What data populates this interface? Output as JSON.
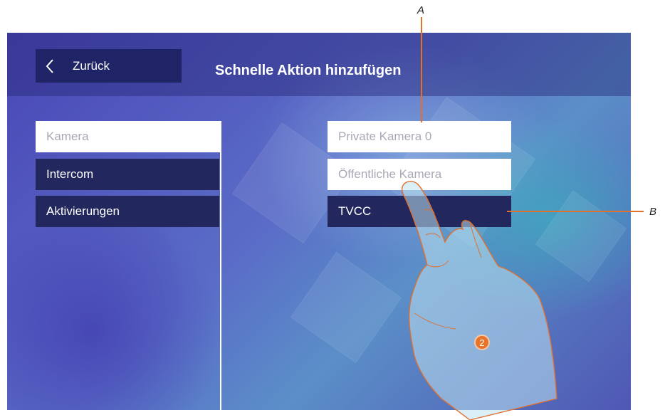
{
  "header": {
    "back_label": "Zurück",
    "title": "Schnelle Aktion hinzufügen"
  },
  "categories": [
    {
      "label": "Kamera",
      "selected": true
    },
    {
      "label": "Intercom",
      "selected": false
    },
    {
      "label": "Aktivierungen",
      "selected": false
    }
  ],
  "options": [
    {
      "label": "Private Kamera 0",
      "selected": true
    },
    {
      "label": "Öffentliche Kamera",
      "selected": true
    },
    {
      "label": "TVCC",
      "selected": false
    }
  ],
  "callouts": {
    "a": "A",
    "b": "B"
  },
  "step_badge": "2",
  "colors": {
    "accent": "#e8732a",
    "button_dark": "#22285e",
    "header_bg": "#1f2466"
  },
  "icons": {
    "back": "chevron-left-icon",
    "hand": "pointing-hand-icon"
  }
}
